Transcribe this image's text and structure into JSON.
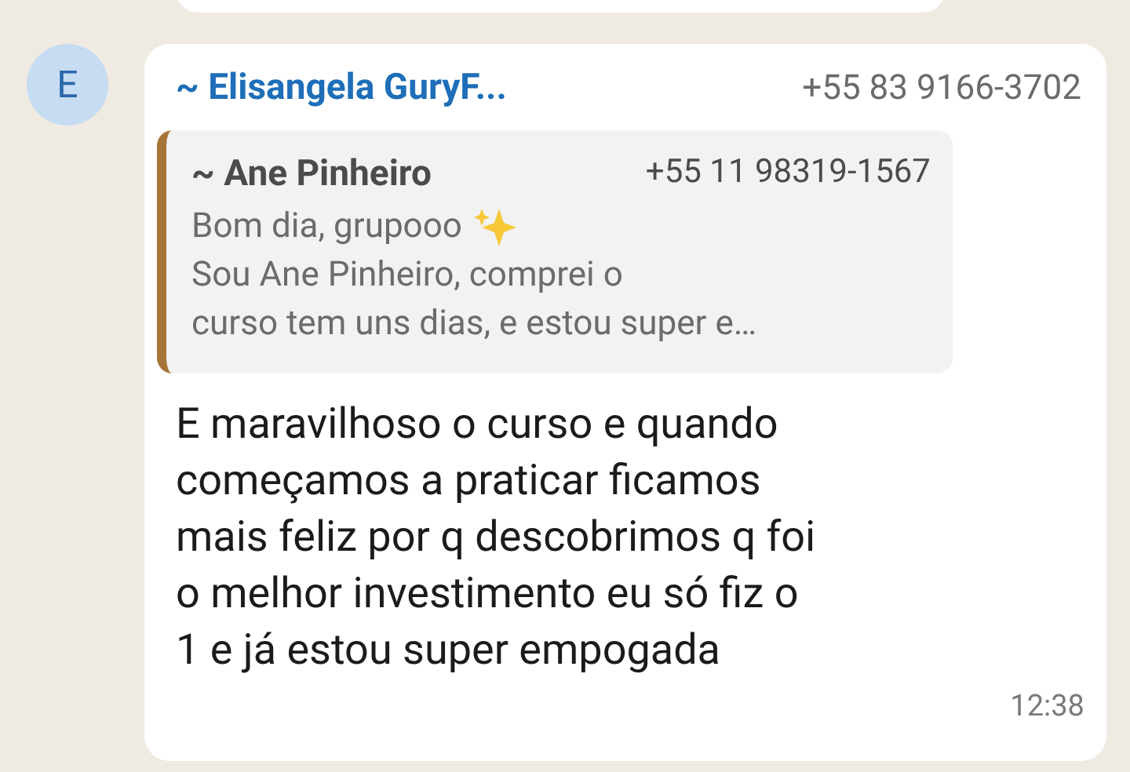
{
  "avatar": {
    "initial": "E"
  },
  "message": {
    "sender": "~ Elisangela GuryF...",
    "phone": "+55 83 9166-3702",
    "quote": {
      "sender": "~ Ane Pinheiro",
      "phone": "+55 11 98319-1567",
      "lines": [
        "Bom dia, grupooo",
        "Sou Ane Pinheiro, comprei o",
        "curso tem uns dias, e estou super e…"
      ]
    },
    "text": "E maravilhoso o curso e quando\ncomeçamos a praticar ficamos\nmais feliz por q descobrimos q foi\no melhor investimento eu só fiz o\n1 e já estou super empogada",
    "time": "12:38"
  }
}
